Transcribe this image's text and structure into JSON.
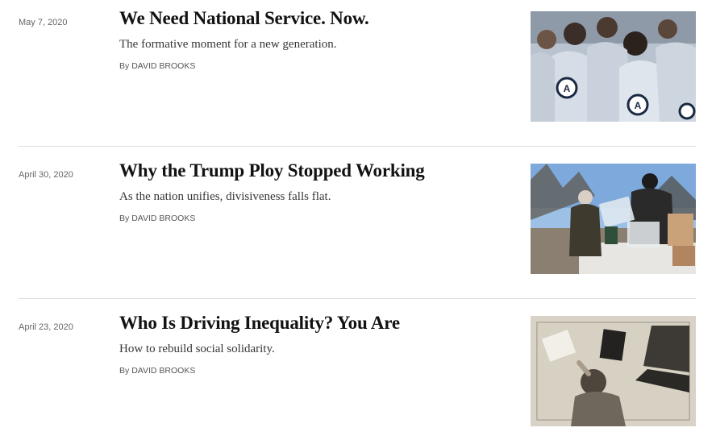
{
  "articles": [
    {
      "date": "May 7, 2020",
      "headline": "We Need National Service. Now.",
      "summary": "The formative moment for a new generation.",
      "byline_prefix": "By",
      "author": "DAVID BROOKS",
      "image_icon": "americorps-volunteers-photo"
    },
    {
      "date": "April 30, 2020",
      "headline": "Why the Trump Ploy Stopped Working",
      "summary": "As the nation unifies, divisiveness falls flat.",
      "byline_prefix": "By",
      "author": "DAVID BROOKS",
      "image_icon": "food-distribution-photo"
    },
    {
      "date": "April 23, 2020",
      "headline": "Who Is Driving Inequality? You Are",
      "summary": "How to rebuild social solidarity.",
      "byline_prefix": "By",
      "author": "DAVID BROOKS",
      "image_icon": "child-at-desk-photo"
    }
  ]
}
